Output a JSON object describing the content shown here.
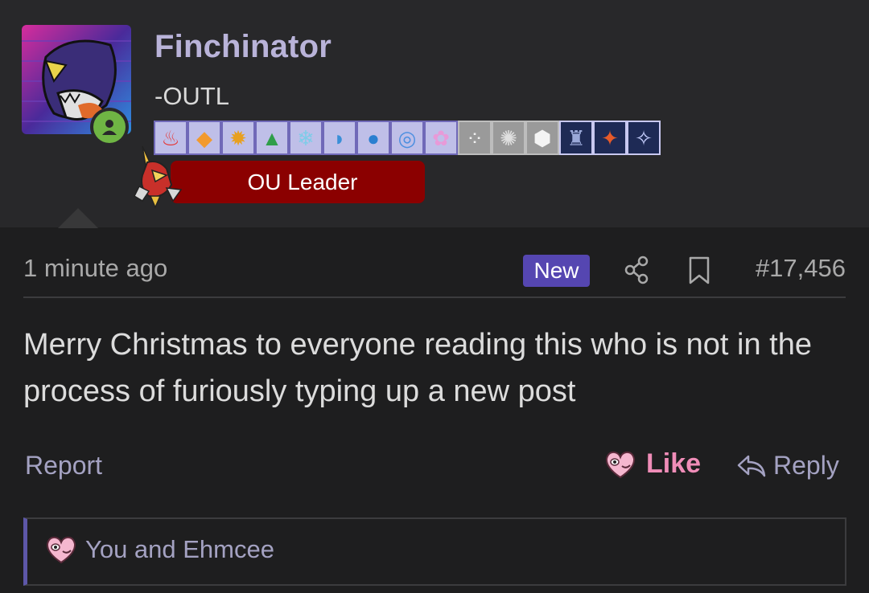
{
  "user": {
    "name": "Finchinator",
    "title": "-OUTL",
    "role": "OU Leader",
    "online": true
  },
  "badges": [
    {
      "icon": "fire-badge"
    },
    {
      "icon": "diamond-badge"
    },
    {
      "icon": "sun-badge"
    },
    {
      "icon": "leaf-badge"
    },
    {
      "icon": "ice-badge"
    },
    {
      "icon": "wave-badge"
    },
    {
      "icon": "drop-badge"
    },
    {
      "icon": "psychic-badge"
    },
    {
      "icon": "fairy-badge"
    },
    {
      "icon": "steel-chain-badge"
    },
    {
      "icon": "gear-badge"
    },
    {
      "icon": "rock-badge"
    },
    {
      "icon": "trophy-badge"
    },
    {
      "icon": "medal-badge"
    },
    {
      "icon": "star-medal-badge"
    }
  ],
  "post": {
    "time": "1 minute ago",
    "new_label": "New",
    "number": "#17,456",
    "body": "Merry Christmas to everyone reading this who is not in the process of furiously typing up a new post"
  },
  "actions": {
    "report": "Report",
    "like": "Like",
    "reply": "Reply"
  },
  "likes_summary": "You and Ehmcee",
  "colors": {
    "accent": "#5546b1",
    "username": "#b9b3d9",
    "role_bg": "#8b0000",
    "like": "#f08db8",
    "online": "#6fb544"
  }
}
